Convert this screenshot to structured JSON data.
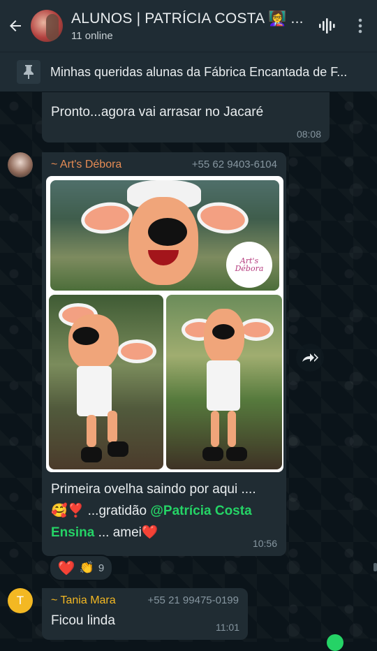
{
  "header": {
    "title": "ALUNOS | PATRÍCIA COSTA 👩‍🏫 ...",
    "subtitle": "11 online"
  },
  "pinned": {
    "text": "Minhas queridas alunas da Fábrica Encantada de F..."
  },
  "messages": [
    {
      "text": "Pronto...agora vai arrasar no Jacaré",
      "time": "08:08"
    },
    {
      "sender": "~ Art's Débora",
      "phone": "+55 62 9403-6104",
      "caption_part1": "Primeira ovelha saindo por aqui ....",
      "caption_emojis": "🥰❣️",
      "caption_part2": " ...gratidão ",
      "mention": "@Patrícia Costa Ensina",
      "caption_part3": " ... amei",
      "caption_end_emoji": "❤️",
      "time": "10:56",
      "logo_text": "Art's Débora",
      "reactions": {
        "hearts": "❤️",
        "clap": "👏",
        "count": "9"
      }
    },
    {
      "avatar_letter": "T",
      "sender": "~ Tania Mara",
      "phone": "+55 21 99475-0199",
      "text": "Ficou linda",
      "time": "11:01"
    }
  ],
  "icons": {
    "back": "arrow-left",
    "voice": "audio-wave",
    "menu": "more-vertical",
    "pin": "pin",
    "forward": "forward-double"
  },
  "colors": {
    "chat_bg": "#0b141a",
    "bubble": "#202c33",
    "header": "#1f2c34",
    "sender_orange": "#e58b54",
    "sender_yellow": "#f3b823",
    "mention_green": "#25d366"
  }
}
